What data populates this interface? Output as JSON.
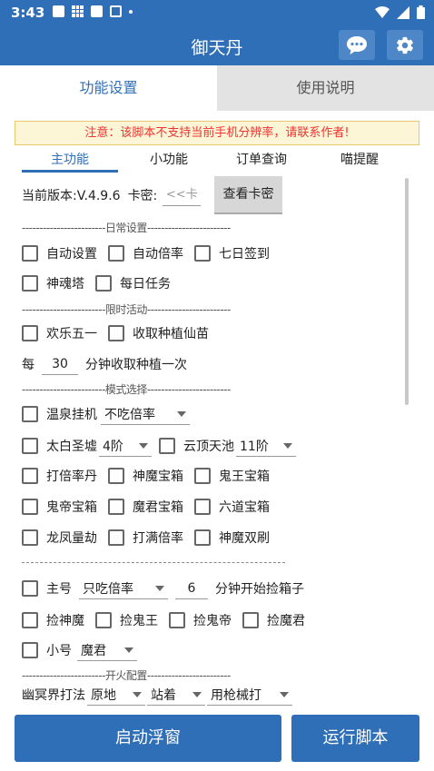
{
  "status": {
    "time": "3:43",
    "notif_icons": [
      "square-icon",
      "grid-icon",
      "square-icon",
      "outline-square-icon",
      "dot-icon"
    ],
    "sys_icons": [
      "wifi-icon",
      "signal-icon",
      "battery-icon"
    ]
  },
  "appbar": {
    "title": "御天丹",
    "chat_icon": "chat-icon",
    "settings_icon": "gear-icon",
    "color": "#2f6fb8"
  },
  "main_tabs": [
    {
      "label": "功能设置",
      "active": true
    },
    {
      "label": "使用说明",
      "active": false
    }
  ],
  "notice": "注意：该脚本不支持当前手机分辨率，请联系作者!",
  "sub_tabs": [
    {
      "label": "主功能",
      "active": true
    },
    {
      "label": "小功能",
      "active": false
    },
    {
      "label": "订单查询",
      "active": false
    },
    {
      "label": "喵提醒",
      "active": false
    }
  ],
  "version": {
    "label": "当前版本:V.4.9.6",
    "card_label": "卡密:",
    "card_placeholder": "<<卡",
    "check_button": "查看卡密"
  },
  "sections": {
    "daily": "------------------------日常设置------------------------",
    "limited": "------------------------限时活动------------------------",
    "mode": "------------------------模式选择------------------------",
    "fire": "------------------------开火配置------------------------"
  },
  "daily_items": [
    "自动设置",
    "自动倍率",
    "七日签到",
    "神魂塔",
    "每日任务"
  ],
  "limited_items": [
    "欢乐五一",
    "收取种植仙苗"
  ],
  "harvest": {
    "prefix": "每",
    "value": "30",
    "suffix": "分钟收取种植一次"
  },
  "mode": {
    "hotspring_label": "温泉挂机",
    "hotspring_value": "不吃倍率",
    "taibai_label": "太白圣墟",
    "taibai_value": "4阶",
    "yunding_label": "云顶天池",
    "yunding_value": "11阶",
    "items_row3": [
      "打倍率丹",
      "神魔宝箱",
      "鬼王宝箱"
    ],
    "items_row4": [
      "鬼帝宝箱",
      "魔君宝箱",
      "六道宝箱"
    ],
    "items_row5": [
      "龙凤量劫",
      "打满倍率",
      "神魔双刷"
    ]
  },
  "main_account": {
    "label": "主号",
    "mode_value": "只吃倍率",
    "minutes": "6",
    "suffix": "分钟开始捡箱子",
    "pick_items": [
      "捡神魔",
      "捡鬼王",
      "捡鬼帝",
      "捡魔君"
    ],
    "alt_label": "小号",
    "alt_value": "魔君"
  },
  "fire": {
    "label": "幽冥界打法",
    "opt1": "原地",
    "opt2": "站着",
    "opt3": "用枪械打"
  },
  "buttons": {
    "float": "启动浮窗",
    "run": "运行脚本"
  }
}
